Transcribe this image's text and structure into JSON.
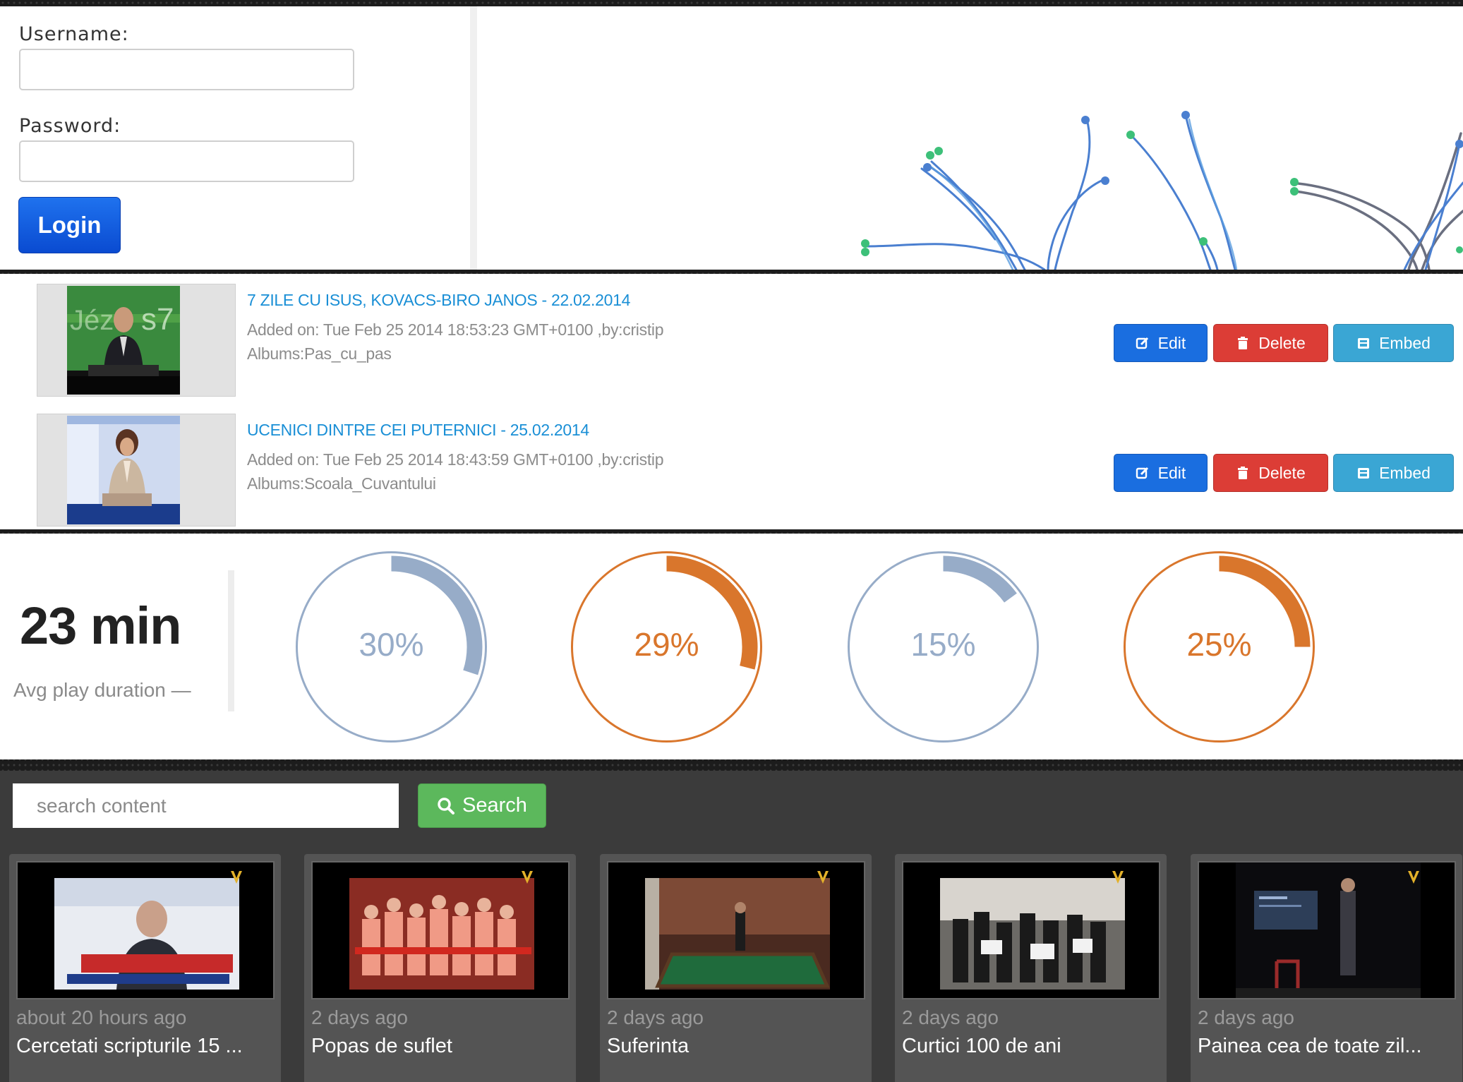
{
  "login": {
    "username_label": "Username:",
    "password_label": "Password:",
    "username_value": "",
    "password_value": "",
    "login_button": "Login"
  },
  "videos": [
    {
      "title": "7 ZILE CU ISUS, KOVACS-BIRO JANOS - 22.02.2014",
      "added": "Added on: Tue Feb 25 2014 18:53:23 GMT+0100 ,by:cristip",
      "albums": "Albums:Pas_cu_pas",
      "edit": "Edit",
      "delete": "Delete",
      "embed": "Embed"
    },
    {
      "title": "UCENICI DINTRE CEI PUTERNICI - 25.02.2014",
      "added": "Added on: Tue Feb 25 2014 18:43:59 GMT+0100 ,by:cristip",
      "albums": "Albums:Scoala_Cuvantului",
      "edit": "Edit",
      "delete": "Delete",
      "embed": "Embed"
    }
  ],
  "stats": {
    "avg_value": "23 min",
    "avg_label": "Avg play duration —",
    "gauges": [
      {
        "label": "30%",
        "value": 0.3,
        "color": "#97acc8"
      },
      {
        "label": "29%",
        "value": 0.29,
        "color": "#d9762c"
      },
      {
        "label": "15%",
        "value": 0.15,
        "color": "#97acc8"
      },
      {
        "label": "25%",
        "value": 0.25,
        "color": "#d9762c"
      }
    ]
  },
  "gallery": {
    "search_placeholder": "search content",
    "search_button": "Search",
    "items": [
      {
        "time": "about 20 hours ago",
        "title": "Cercetati scripturile 15 ..."
      },
      {
        "time": "2 days ago",
        "title": "Popas de suflet"
      },
      {
        "time": "2 days ago",
        "title": "Suferinta"
      },
      {
        "time": "2 days ago",
        "title": "Curtici 100 de ani"
      },
      {
        "time": "2 days ago",
        "title": "Painea cea de toate zil..."
      }
    ]
  },
  "colors": {
    "link_blue": "#1a8fd6",
    "edit_blue": "#1a6ee0",
    "delete_red": "#dc3d36",
    "embed_cyan": "#3aa6d4",
    "search_green": "#5cb85c",
    "gauge_blue": "#97acc8",
    "gauge_orange": "#d9762c"
  }
}
